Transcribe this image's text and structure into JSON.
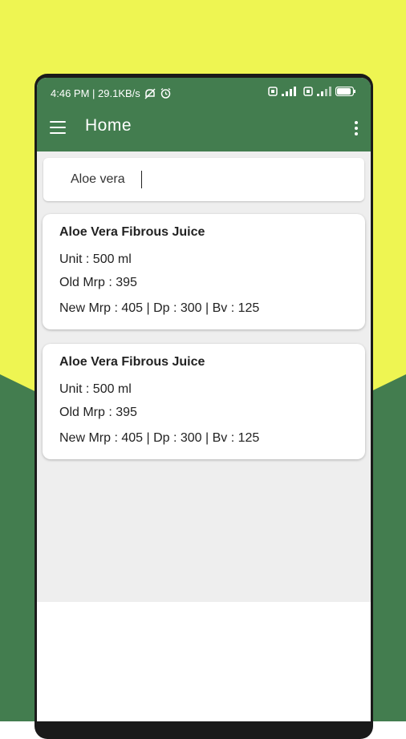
{
  "colors": {
    "yellow_bg": "#eef552",
    "green": "#437d4f"
  },
  "status_bar": {
    "time_speed": "4:46 PM | 29.1KB/s",
    "icons": [
      "mute-icon",
      "alarm-icon",
      "sim-icon",
      "signal-icon",
      "battery-icon"
    ],
    "battery": "80"
  },
  "toolbar": {
    "title": "Home",
    "menu_icon": "hamburger-menu-icon",
    "more_icon": "more-vertical-icon"
  },
  "search": {
    "value": "Aloe vera"
  },
  "products": [
    {
      "name": "Aloe Vera Fibrous Juice",
      "unit": "Unit : 500 ml",
      "old_mrp": "Old Mrp : 395",
      "prices": "New Mrp : 405 | Dp : 300 | Bv : 125"
    },
    {
      "name": "Aloe Vera Fibrous Juice",
      "unit": "Unit : 500 ml",
      "old_mrp": "Old Mrp : 395",
      "prices": "New Mrp : 405 | Dp : 300 | Bv : 125"
    }
  ]
}
